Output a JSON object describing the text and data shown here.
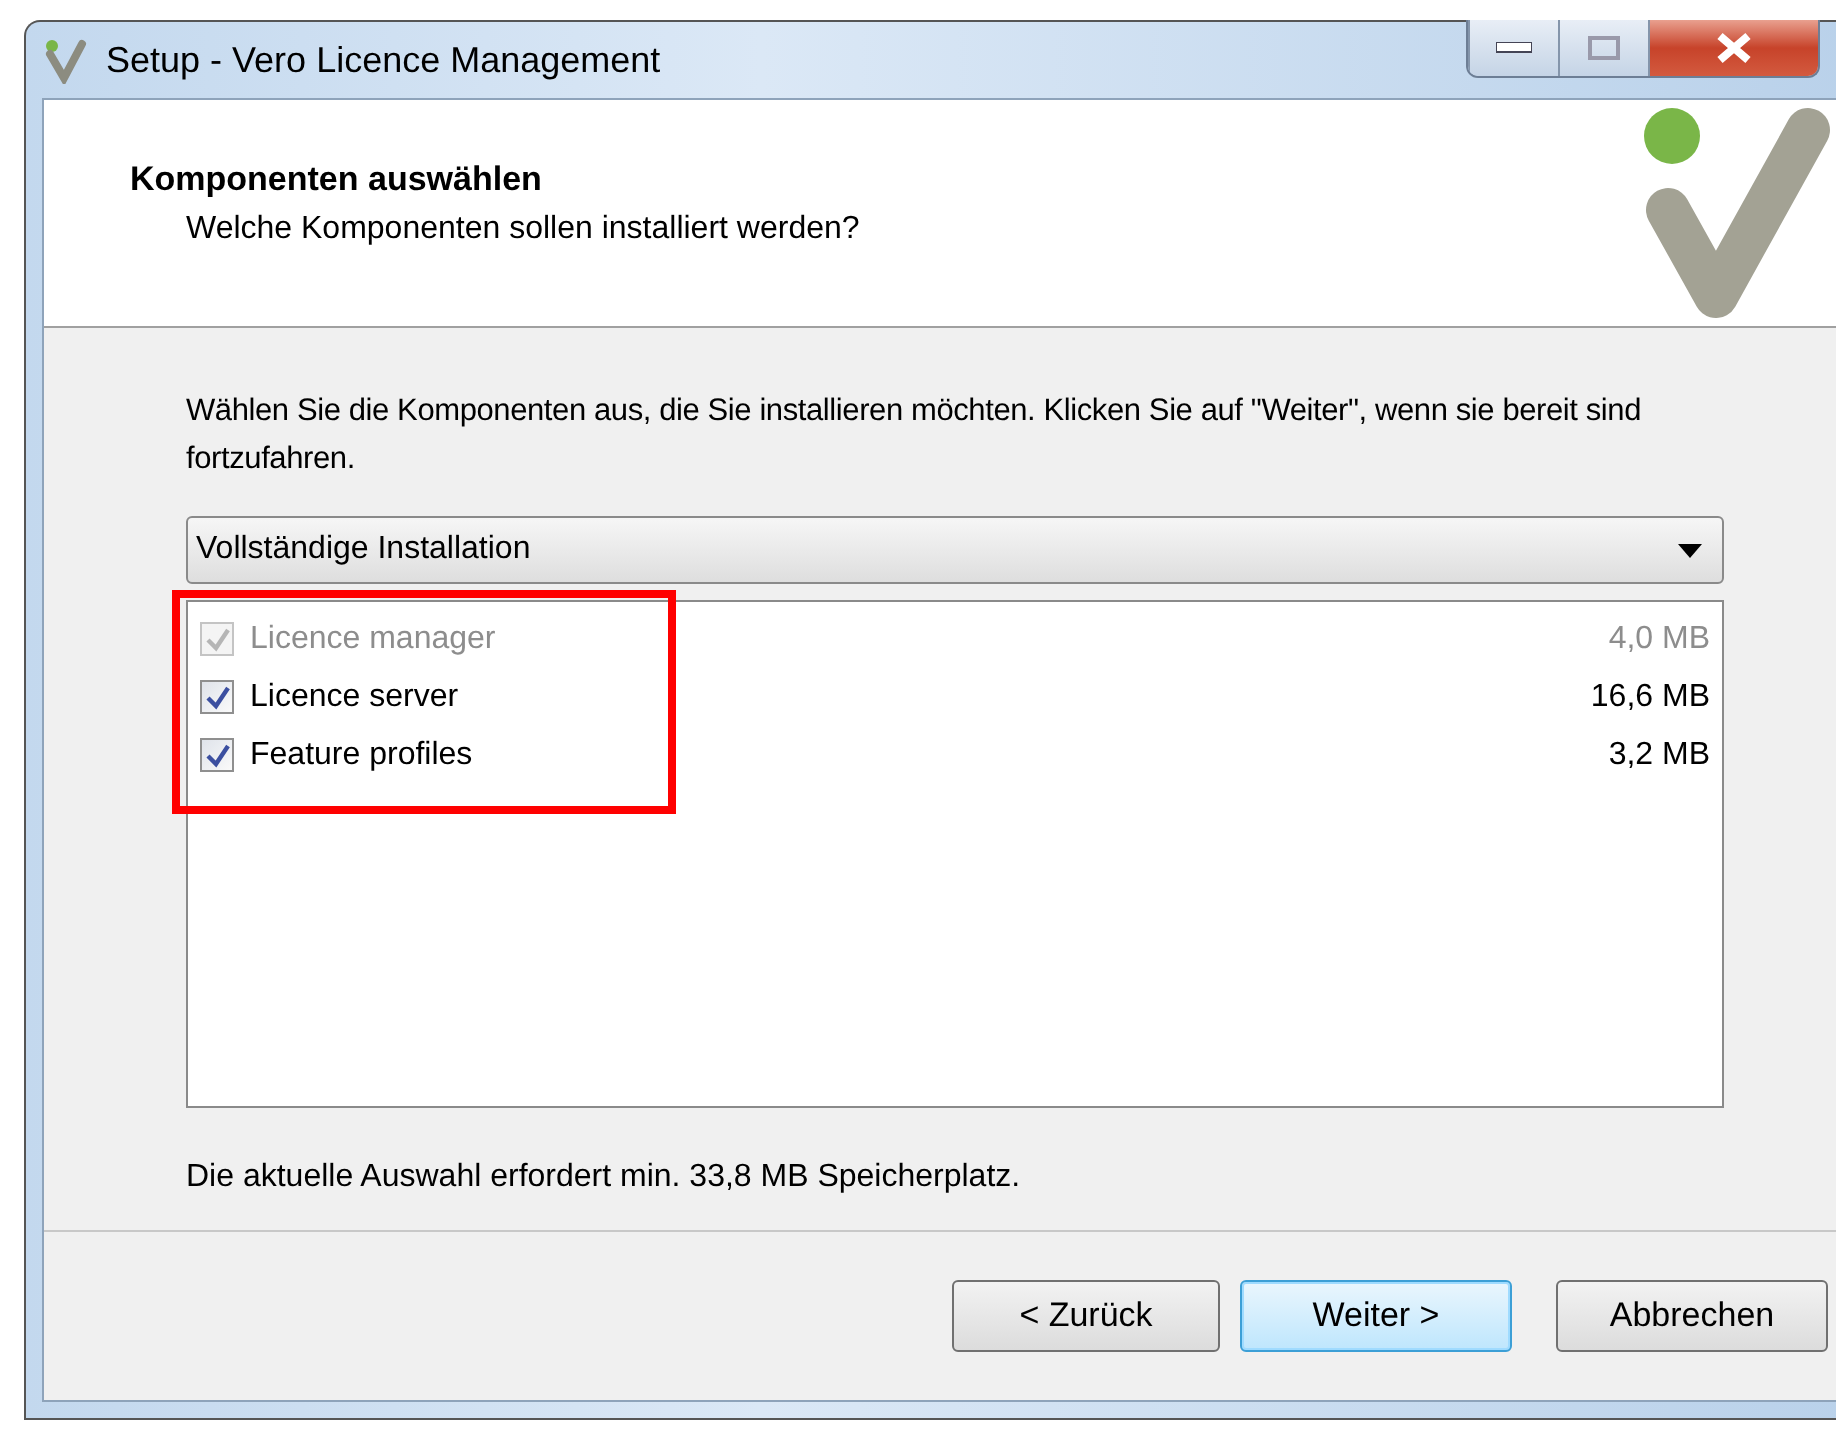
{
  "window": {
    "title": "Setup - Vero Licence Management"
  },
  "header": {
    "title": "Komponenten auswählen",
    "subtitle": "Welche Komponenten sollen installiert werden?"
  },
  "instructions": "Wählen Sie die Komponenten aus, die Sie installieren möchten. Klicken Sie auf \"Weiter\", wenn sie bereit sind fortzufahren.",
  "setup_type": {
    "value": "Vollständige Installation"
  },
  "components": [
    {
      "name": "Licence manager",
      "size": "4,0 MB",
      "checked": true,
      "disabled": true
    },
    {
      "name": "Licence server",
      "size": "16,6 MB",
      "checked": true,
      "disabled": false
    },
    {
      "name": "Feature profiles",
      "size": "3,2 MB",
      "checked": true,
      "disabled": false
    }
  ],
  "highlight": {
    "shown": true
  },
  "space_note": "Die aktuelle Auswahl erfordert min. 33,8 MB Speicherplatz.",
  "buttons": [
    {
      "label": "< Zurück",
      "default": false
    },
    {
      "label": "Weiter >",
      "default": true
    },
    {
      "label": "Abbrechen",
      "default": false
    }
  ]
}
